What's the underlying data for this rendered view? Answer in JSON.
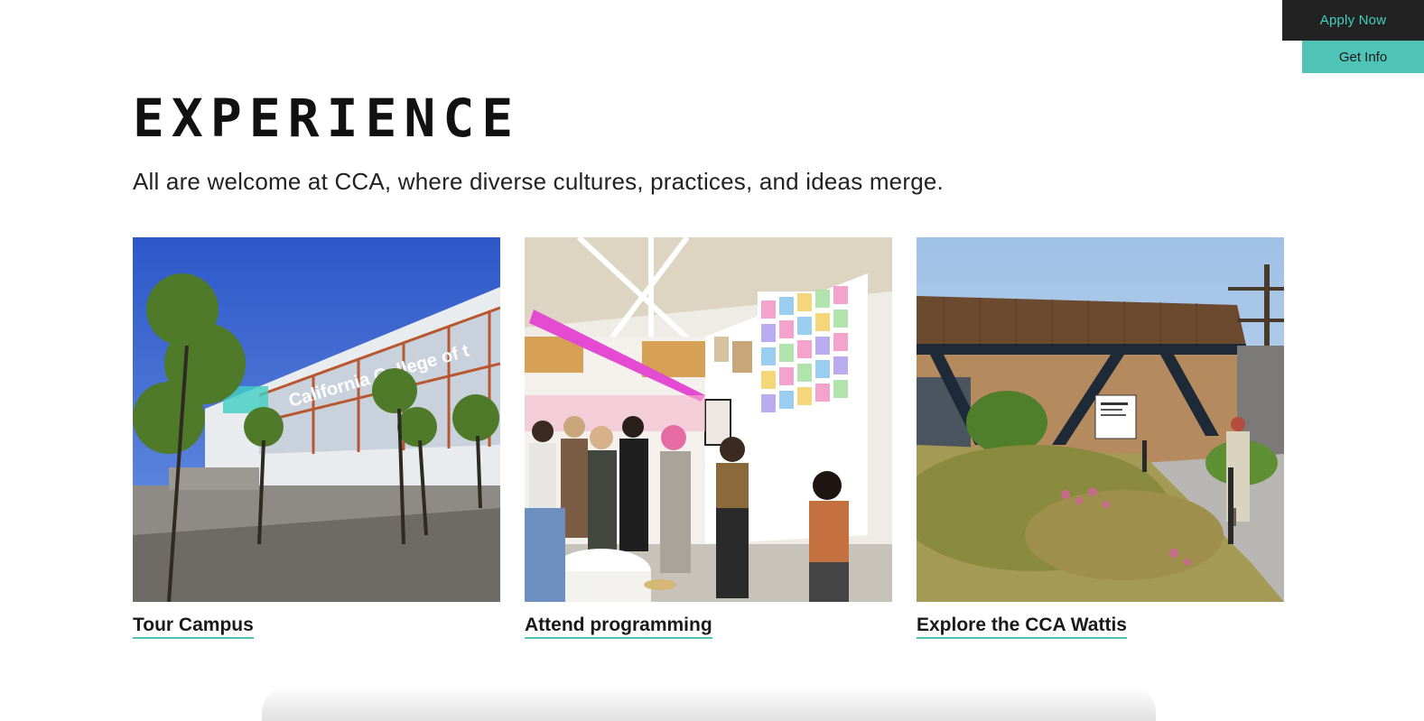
{
  "cta": {
    "apply_label": "Apply Now",
    "info_label": "Get Info"
  },
  "section": {
    "heading": "EXPERIENCE",
    "intro": "All are welcome at CCA, where diverse cultures, practices, and ideas merge."
  },
  "cards": [
    {
      "label": "Tour Campus",
      "image_sign": "California College of t"
    },
    {
      "label": "Attend programming"
    },
    {
      "label": "Explore the CCA Wattis"
    }
  ],
  "colors": {
    "accent": "#4fc4b6",
    "apply_bg": "#222222",
    "apply_text": "#3fd0c2"
  }
}
